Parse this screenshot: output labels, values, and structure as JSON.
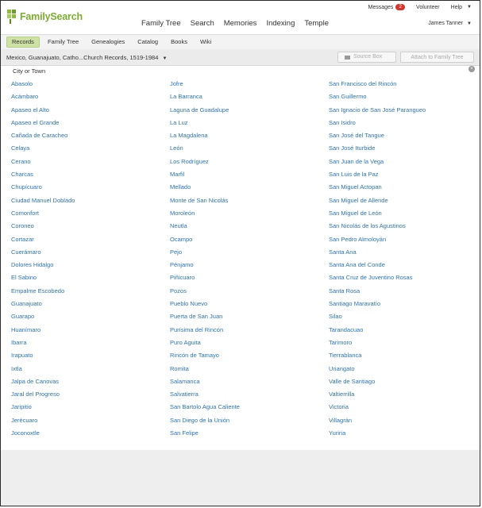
{
  "brand": {
    "name": "FamilySearch",
    "accent": "#7cae2d",
    "link_color": "#2a74b6"
  },
  "utility_nav": {
    "messages_label": "Messages",
    "messages_count": "2",
    "volunteer_label": "Volunteer",
    "help_label": "Help",
    "user_name": "James Tanner"
  },
  "main_nav": [
    "Family Tree",
    "Search",
    "Memories",
    "Indexing",
    "Temple"
  ],
  "sub_nav": {
    "items": [
      "Records",
      "Family Tree",
      "Genealogies",
      "Catalog",
      "Books",
      "Wiki"
    ],
    "active": "Records"
  },
  "collection": {
    "title": "Mexico, Guanajuato, Catho...Church Records, 1519-1984",
    "source_box_label": "Source Box",
    "attach_label": "Attach to Family Tree"
  },
  "panel": {
    "title": "City or Town",
    "columns": [
      [
        "Abasolo",
        "Acámbaro",
        "Apaseo el Alto",
        "Apaseo el Grande",
        "Cañada de Caracheo",
        "Celaya",
        "Cerano",
        "Charcas",
        "Chupícuaro",
        "Ciudad Manuel Doblado",
        "Comonfort",
        "Coroneo",
        "Cortazar",
        "Cuerámaro",
        "Dolores Hidalgo",
        "El Sabino",
        "Empalme Escobedo",
        "Guanajuato",
        "Guarapo",
        "Huanímaro",
        "Ibarra",
        "Irapuato",
        "Ixtla",
        "Jalpa de Canovas",
        "Jaral del Progreso",
        "Jaripitio",
        "Jerécuaro",
        "Joconoxtle"
      ],
      [
        "Jofre",
        "La Barranca",
        "Laguna de Guadalupe",
        "La Luz",
        "La Magdalena",
        "León",
        "Los Rodríguez",
        "Marfil",
        "Mellado",
        "Monte de San Nicolás",
        "Moroleón",
        "Neutla",
        "Ocampo",
        "Pejo",
        "Pénjamo",
        "Piñicuaro",
        "Pozos",
        "Pueblo Nuevo",
        "Puerta de San Juan",
        "Purísima del Rincón",
        "Puro Aguita",
        "Rincón de Tamayo",
        "Romita",
        "Salamanca",
        "Salvatierra",
        "San Bartolo Agua Caliente",
        "San Diego de la Unión",
        "San Felipe"
      ],
      [
        "San Francisco del Rincón",
        "San Guillermo",
        "San Ignacio de San José Parangueo",
        "San Isidro",
        "San José del Tangue",
        "San José Iturbide",
        "San Juan de la Vega",
        "San Luis de la Paz",
        "San Miguel Actopan",
        "San Miguel de Allende",
        "San Miguel de León",
        "San Nicolás de los Agustinos",
        "San Pedro Almoloyán",
        "Santa Ana",
        "Santa Ana del Conde",
        "Santa Cruz de Juventino Rosas",
        "Santa Rosa",
        "Santiago Maravatío",
        "Silao",
        "Tarandacuao",
        "Tarimoro",
        "Tierrablanca",
        "Uriangato",
        "Valle de Santiago",
        "Valtierrilla",
        "Victoria",
        "Villagrán",
        "Yuriria"
      ]
    ]
  }
}
